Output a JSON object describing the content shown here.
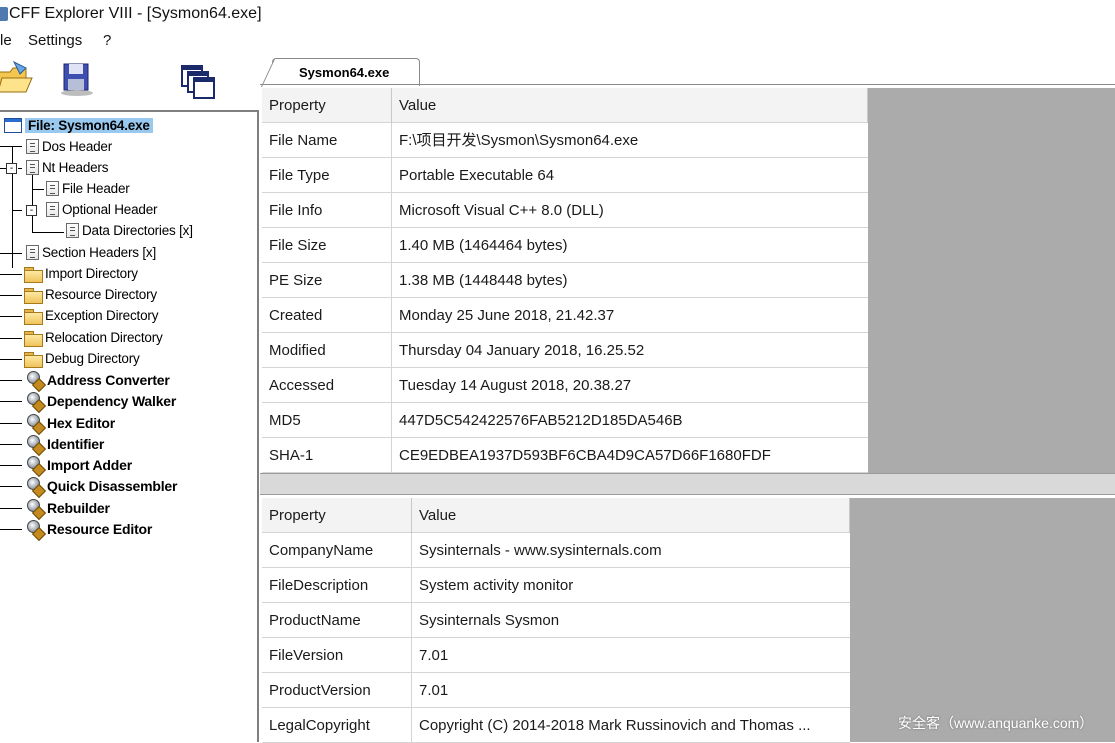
{
  "window": {
    "title": "CFF Explorer VIII - [Sysmon64.exe]"
  },
  "menu": {
    "items": [
      "le",
      "Settings",
      "?"
    ]
  },
  "toolbar": {
    "buttons": [
      "open-folder-icon",
      "save-disk-icon",
      "windows-icon"
    ]
  },
  "tree": {
    "root": "File: Sysmon64.exe",
    "dos_header": "Dos Header",
    "nt_headers": "Nt Headers",
    "file_header": "File Header",
    "optional_header": "Optional Header",
    "data_directories": "Data Directories [x]",
    "section_headers": "Section Headers [x]",
    "import_directory": "Import Directory",
    "resource_directory": "Resource Directory",
    "exception_directory": "Exception Directory",
    "relocation_directory": "Relocation Directory",
    "debug_directory": "Debug Directory",
    "tools": [
      "Address Converter",
      "Dependency Walker",
      "Hex Editor",
      "Identifier",
      "Import Adder",
      "Quick Disassembler",
      "Rebuilder",
      "Resource Editor"
    ],
    "expander_minus": "-"
  },
  "tab": {
    "label": "Sysmon64.exe"
  },
  "file_table": {
    "headers": [
      "Property",
      "Value"
    ],
    "rows": [
      [
        "File Name",
        "F:\\项目开发\\Sysmon\\Sysmon64.exe"
      ],
      [
        "File Type",
        "Portable Executable 64"
      ],
      [
        "File Info",
        "Microsoft Visual C++ 8.0 (DLL)"
      ],
      [
        "File Size",
        "1.40 MB (1464464 bytes)"
      ],
      [
        "PE Size",
        "1.38 MB (1448448 bytes)"
      ],
      [
        "Created",
        "Monday 25 June 2018, 21.42.37"
      ],
      [
        "Modified",
        "Thursday 04 January 2018, 16.25.52"
      ],
      [
        "Accessed",
        "Tuesday 14 August 2018, 20.38.27"
      ],
      [
        "MD5",
        "447D5C542422576FAB5212D185DA546B"
      ],
      [
        "SHA-1",
        "CE9EDBEA1937D593BF6CBA4D9CA57D66F1680FDF"
      ]
    ]
  },
  "version_table": {
    "headers": [
      "Property",
      "Value"
    ],
    "rows": [
      [
        "CompanyName",
        "Sysinternals - www.sysinternals.com"
      ],
      [
        "FileDescription",
        "System activity monitor"
      ],
      [
        "ProductName",
        "Sysinternals Sysmon"
      ],
      [
        "FileVersion",
        "7.01"
      ],
      [
        "ProductVersion",
        "7.01"
      ],
      [
        "LegalCopyright",
        "Copyright (C) 2014-2018 Mark Russinovich and Thomas ..."
      ]
    ]
  },
  "watermark": "安全客（www.anquanke.com）"
}
